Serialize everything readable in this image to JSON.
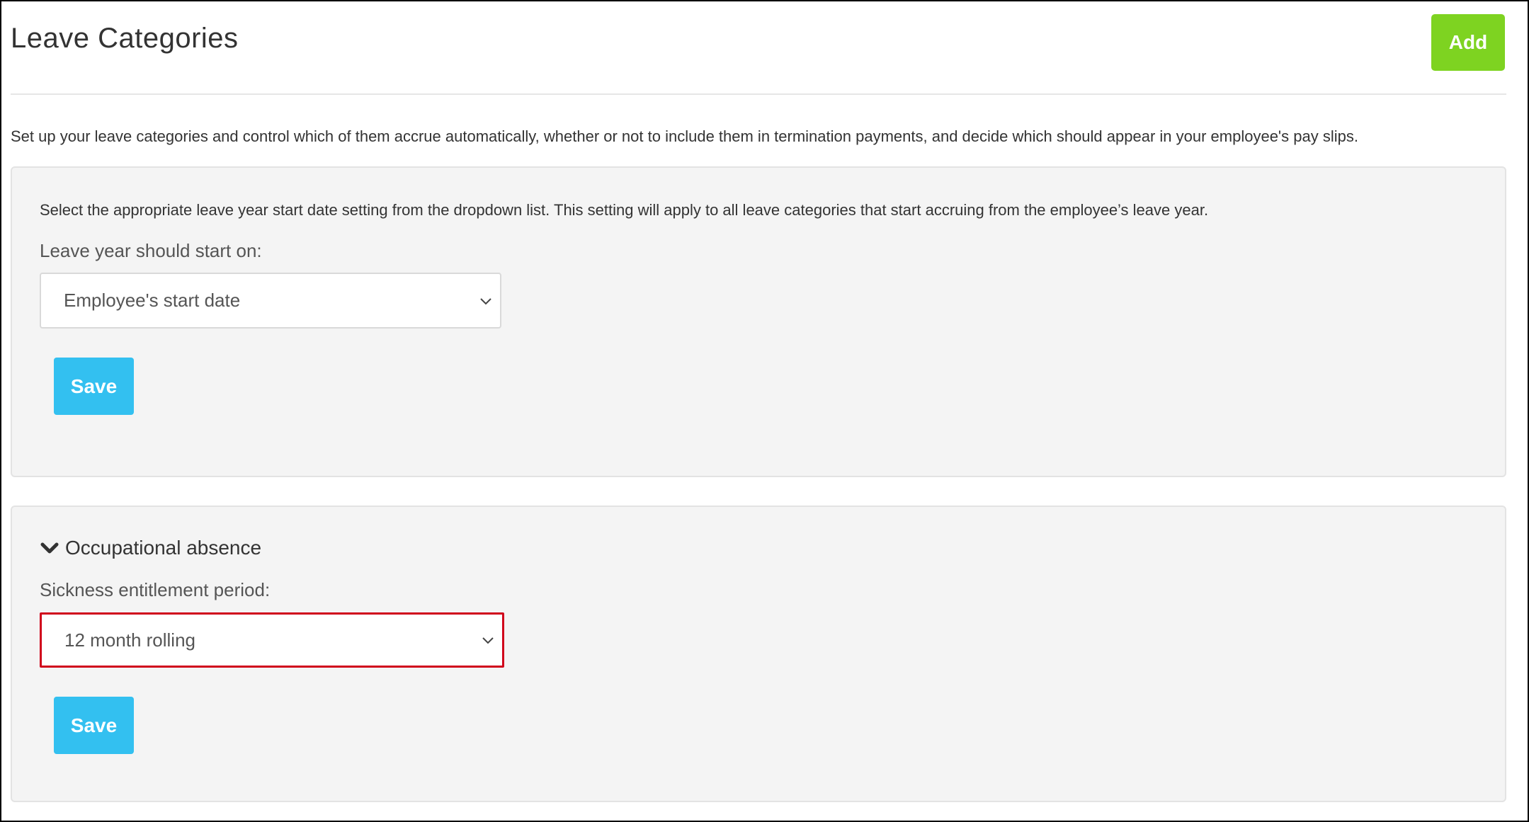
{
  "header": {
    "title": "Leave Categories",
    "add_label": "Add"
  },
  "intro": "Set up your leave categories and control which of them accrue automatically, whether or not to include them in termination payments, and decide which should appear in your employee's pay slips.",
  "leave_year_panel": {
    "description": "Select the appropriate leave year start date setting from the dropdown list. This setting will apply to all leave categories that start accruing from the employee’s leave year.",
    "label": "Leave year should start on:",
    "selected": "Employee's start date",
    "save_label": "Save"
  },
  "occupational_panel": {
    "section_title": "Occupational absence",
    "label": "Sickness entitlement period:",
    "selected": "12 month rolling",
    "save_label": "Save"
  },
  "colors": {
    "add_button": "#7ed321",
    "save_button": "#33c0f0",
    "highlight_border": "#d0021b"
  },
  "icons": {
    "dropdown": "chevron-down-icon",
    "section_toggle": "chevron-down-icon"
  }
}
